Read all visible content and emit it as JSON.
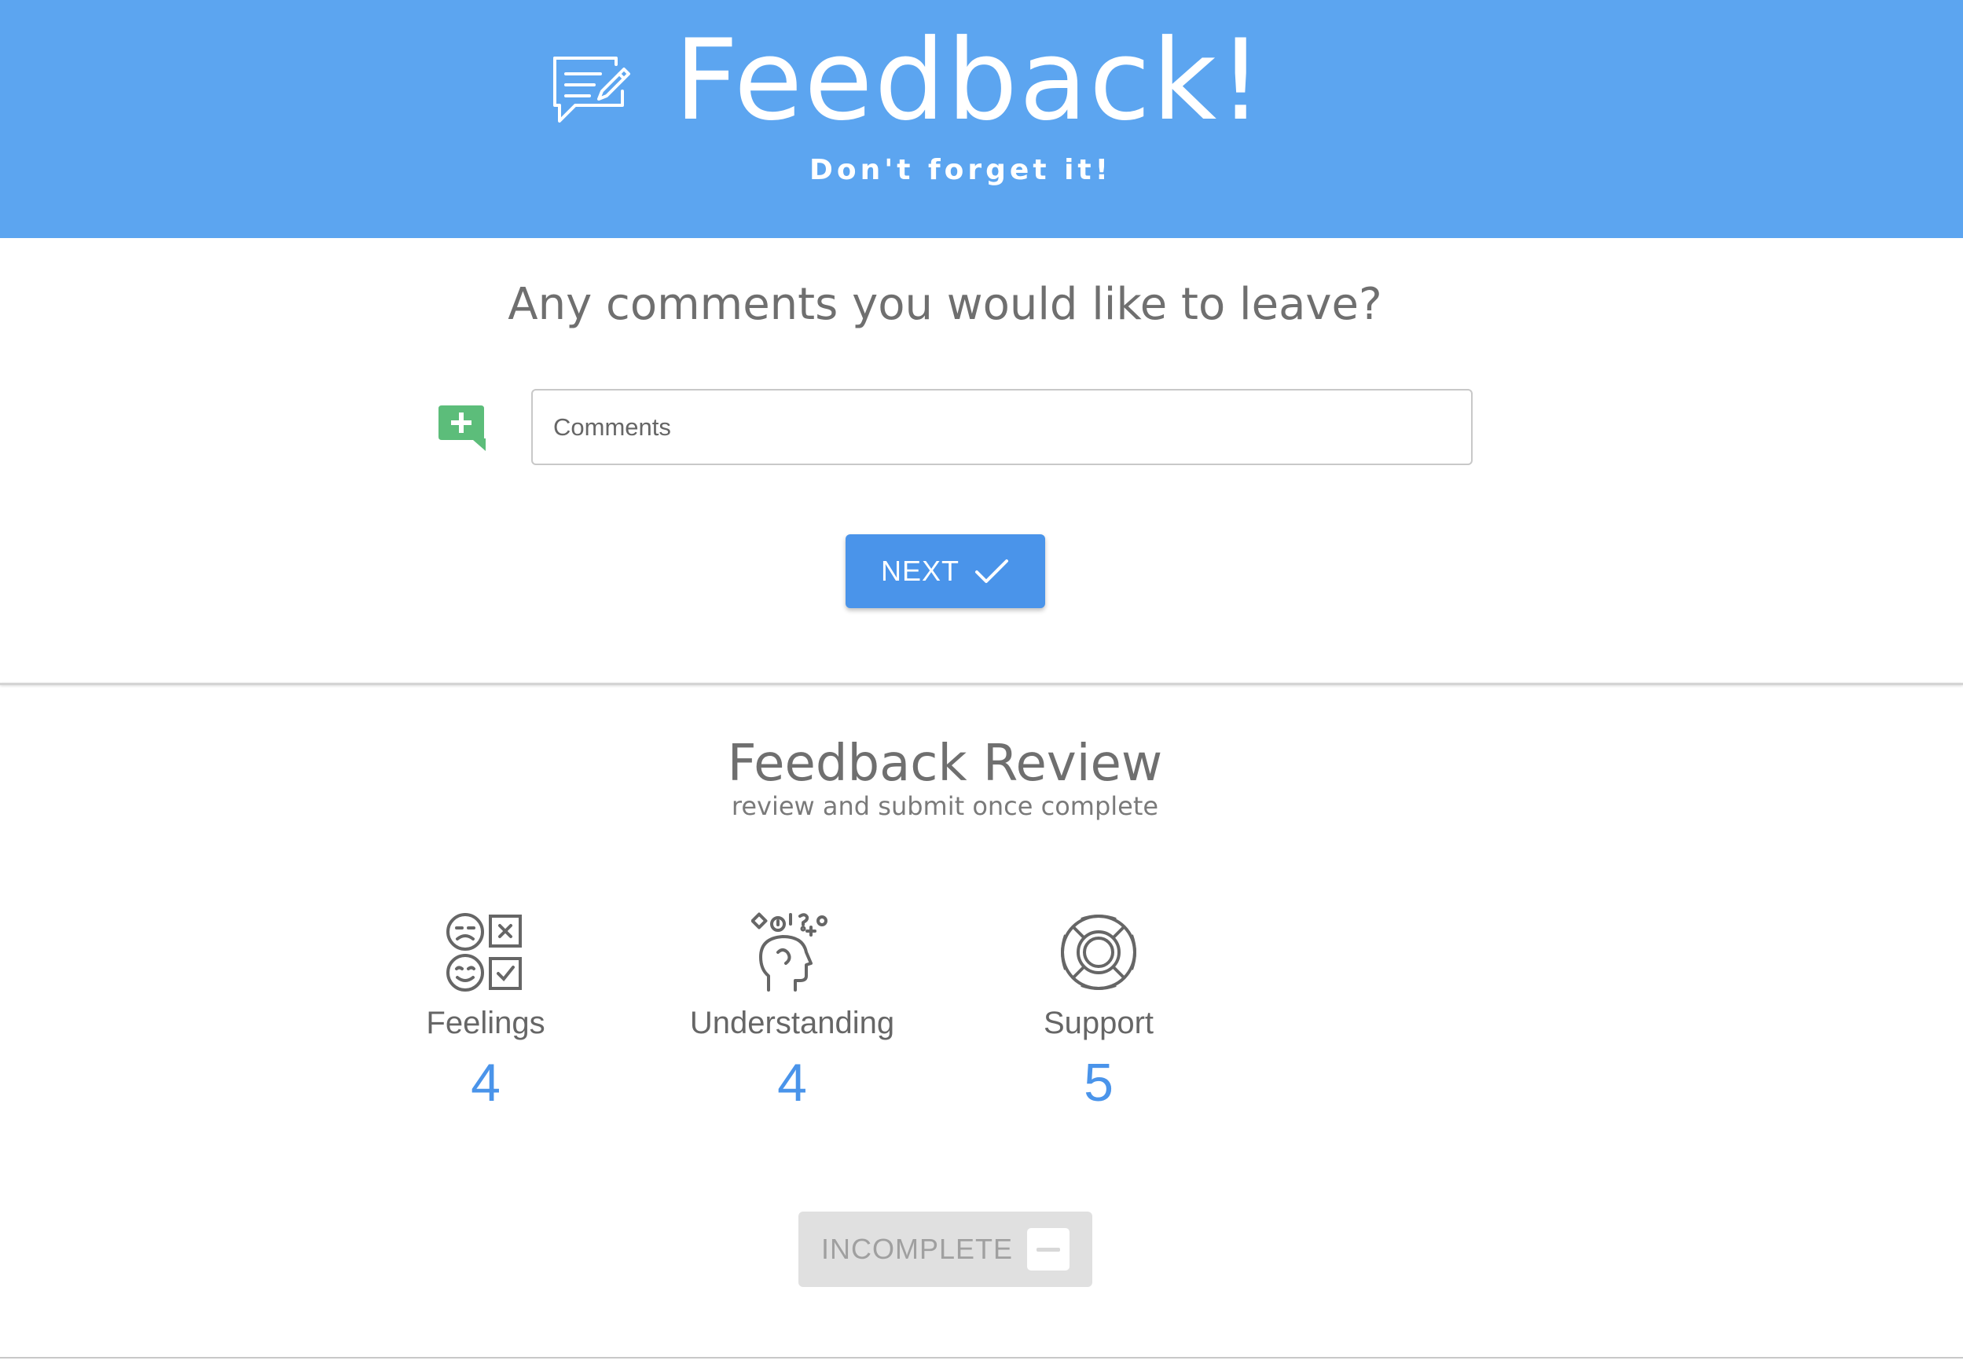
{
  "header": {
    "title": "Feedback!",
    "subtitle": "Don't forget it!",
    "icon": "chat-edit-icon",
    "background_color": "#5ca5f0"
  },
  "comments_step": {
    "question": "Any comments you would like to leave?",
    "icon": "add-comment-icon",
    "icon_color": "#5cbd7a",
    "input_value": "",
    "input_placeholder": "Comments",
    "next_label": "NEXT",
    "next_icon": "check-icon",
    "accent_color": "#4a94ea"
  },
  "review": {
    "title": "Feedback Review",
    "subtitle": "review and submit once complete",
    "metrics": [
      {
        "label": "Feelings",
        "value": "4",
        "icon": "feelings-icon"
      },
      {
        "label": "Understanding",
        "value": "4",
        "icon": "head-thinking-icon"
      },
      {
        "label": "Support",
        "value": "5",
        "icon": "lifebuoy-icon"
      }
    ],
    "status_label": "INCOMPLETE",
    "status_icon": "minus-box-icon"
  }
}
